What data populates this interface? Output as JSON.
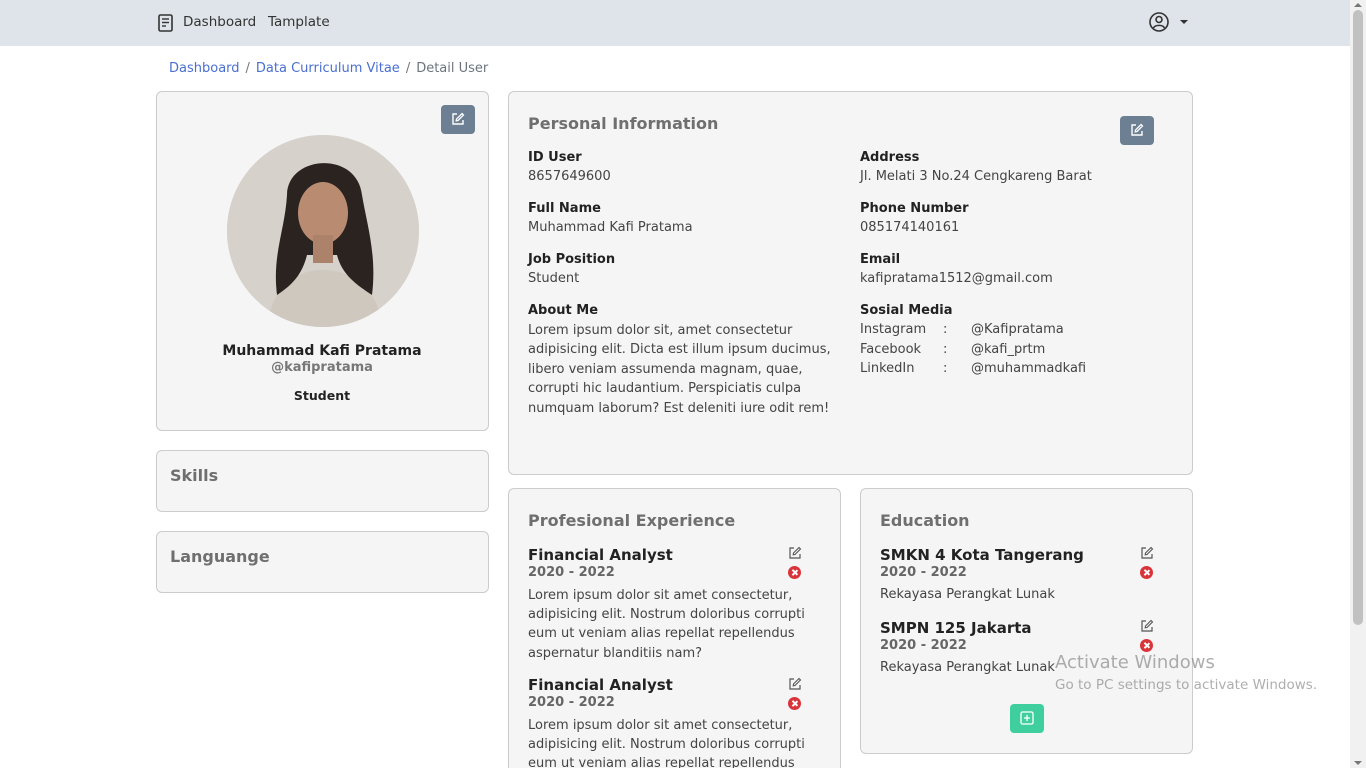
{
  "nav": {
    "brand_icon": "document-icon",
    "links": [
      "Dashboard",
      "Tamplate"
    ],
    "user_icon": "user-circle-icon"
  },
  "breadcrumb": {
    "items": [
      "Dashboard",
      "Data Curriculum Vitae"
    ],
    "separator": "/",
    "current": "Detail User"
  },
  "profile": {
    "name": "Muhammad Kafi Pratama",
    "handle": "@kafipratama",
    "role": "Student"
  },
  "skills": {
    "title": "Skills"
  },
  "language": {
    "title": "Languange"
  },
  "personal": {
    "title": "Personal Information",
    "fields": {
      "id_label": "ID User",
      "id_value": "8657649600",
      "name_label": "Full Name",
      "name_value": "Muhammad Kafi Pratama",
      "job_label": "Job Position",
      "job_value": "Student",
      "about_label": "About Me",
      "about_value": "Lorem ipsum dolor sit, amet consectetur adipisicing elit. Dicta est illum ipsum ducimus, libero veniam assumenda magnam, quae, corrupti hic laudantium. Perspiciatis culpa numquam laborum? Est deleniti iure odit rem!",
      "address_label": "Address",
      "address_value": "Jl. Melati 3 No.24 Cengkareng Barat",
      "phone_label": "Phone Number",
      "phone_value": "085174140161",
      "email_label": "Email",
      "email_value": "kafipratama1512@gmail.com",
      "social_label": "Sosial Media"
    },
    "social": [
      {
        "platform": "Instagram",
        "sep": ":",
        "handle": "@Kafipratama"
      },
      {
        "platform": "Facebook",
        "sep": ":",
        "handle": "@kafi_prtm"
      },
      {
        "platform": "LinkedIn",
        "sep": ":",
        "handle": "@muhammadkafi"
      }
    ]
  },
  "experience": {
    "title": "Profesional Experience",
    "items": [
      {
        "title": "Financial Analyst",
        "years": "2020 - 2022",
        "desc": "Lorem ipsum dolor sit amet consectetur, adipisicing elit. Nostrum doloribus corrupti eum ut veniam alias repellat repellendus aspernatur blanditiis nam?"
      },
      {
        "title": "Financial Analyst",
        "years": "2020 - 2022",
        "desc": "Lorem ipsum dolor sit amet consectetur, adipisicing elit. Nostrum doloribus corrupti eum ut veniam alias repellat repellendus aspernatur blanditiis nam?"
      }
    ]
  },
  "education": {
    "title": "Education",
    "items": [
      {
        "title": "SMKN 4 Kota Tangerang",
        "years": "2020 - 2022",
        "major": "Rekayasa Perangkat Lunak"
      },
      {
        "title": "SMPN 125 Jakarta",
        "years": "2020 - 2022",
        "major": "Rekayasa Perangkat Lunak"
      }
    ]
  },
  "watermark": {
    "title": "Activate Windows",
    "subtitle": "Go to PC settings to activate Windows."
  },
  "colors": {
    "navbar": "#dfe4ea",
    "link": "#4a6fd1",
    "edit_button": "#6c7f93",
    "add_button": "#3fcf9f",
    "delete": "#d9343a"
  }
}
